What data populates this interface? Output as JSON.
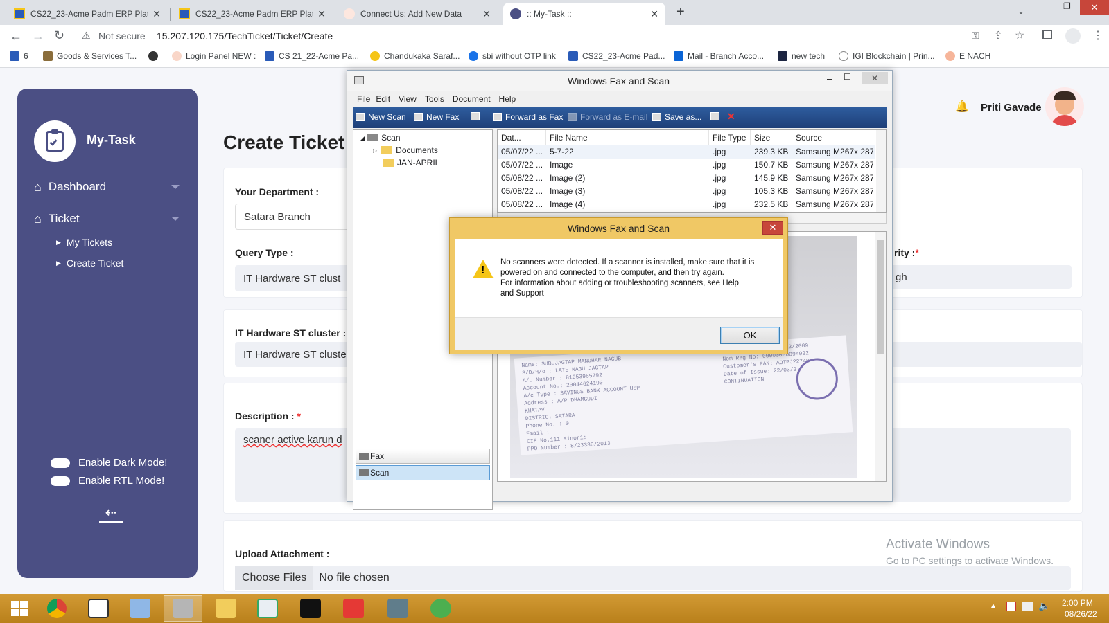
{
  "browser": {
    "tabs": [
      {
        "title": "CS22_23-Acme Padm ERP Platfor",
        "active": false
      },
      {
        "title": "CS22_23-Acme Padm ERP Platfor",
        "active": false
      },
      {
        "title": "Connect Us: Add New Data",
        "active": false
      },
      {
        "title": ":: My-Task ::",
        "active": true
      }
    ],
    "new_tab": "+",
    "security": "Not secure",
    "url": "15.207.120.175/TechTicket/Ticket/Create",
    "bookmarks": [
      "6",
      "Goods & Services T...",
      "",
      "Login Panel NEW :",
      "CS 21_22-Acme Pa...",
      "Chandukaka Saraf...",
      "sbi without OTP link",
      "CS22_23-Acme Pad...",
      "Mail - Branch Acco...",
      "new tech",
      "IGI Blockchain | Prin...",
      "E NACH"
    ]
  },
  "sidebar": {
    "app_name": "My-Task",
    "items": [
      {
        "label": "Dashboard"
      },
      {
        "label": "Ticket"
      }
    ],
    "subitems": [
      {
        "label": "My Tickets"
      },
      {
        "label": "Create Ticket"
      }
    ],
    "toggles": [
      {
        "label": "Enable Dark Mode!"
      },
      {
        "label": "Enable RTL Mode!"
      }
    ]
  },
  "header": {
    "page_title": "Create Ticket",
    "user_name": "Priti Gavade"
  },
  "form": {
    "department_label": "Your Department :",
    "department_value": "Satara Branch",
    "query_type_label": "Query Type :",
    "query_type_value": "IT Hardware ST clust",
    "priority_label": "rity :",
    "priority_value": "gh",
    "cluster_label": "IT Hardware ST cluster :",
    "cluster_value": "IT Hardware ST cluste",
    "description_label": "Description :",
    "description_value": "scaner active karun d",
    "upload_label": "Upload Attachment :",
    "choose_files": "Choose Files",
    "no_file": "No file chosen",
    "required_mark": "*"
  },
  "watermark": {
    "title": "Activate Windows",
    "subtitle": "Go to PC settings to activate Windows."
  },
  "fax_window": {
    "title": "Windows Fax and Scan",
    "menu": [
      "File",
      "Edit",
      "View",
      "Tools",
      "Document",
      "Help"
    ],
    "toolbar": [
      {
        "label": "New Scan",
        "enabled": true
      },
      {
        "label": "New Fax",
        "enabled": true
      },
      {
        "label": "Forward as Fax",
        "enabled": true
      },
      {
        "label": "Forward as E-mail",
        "enabled": false
      },
      {
        "label": "Save as...",
        "enabled": true
      }
    ],
    "tree": {
      "root": "Scan",
      "children": [
        "Documents",
        "JAN-APRIL"
      ]
    },
    "nav": [
      "Fax",
      "Scan"
    ],
    "columns": [
      "Dat...",
      "File Name",
      "File Type",
      "Size",
      "Source"
    ],
    "rows": [
      {
        "date": "05/07/22 ...",
        "name": "5-7-22",
        "type": ".jpg",
        "size": "239.3 KB",
        "source": "Samsung M267x 287x"
      },
      {
        "date": "05/07/22 ...",
        "name": "Image",
        "type": ".jpg",
        "size": "150.7 KB",
        "source": "Samsung M267x 287x"
      },
      {
        "date": "05/08/22 ...",
        "name": "Image (2)",
        "type": ".jpg",
        "size": "145.9 KB",
        "source": "Samsung M267x 287x"
      },
      {
        "date": "05/08/22 ...",
        "name": "Image (3)",
        "type": ".jpg",
        "size": "105.3 KB",
        "source": "Samsung M267x 287x"
      },
      {
        "date": "05/08/22 ...",
        "name": "Image (4)",
        "type": ".jpg",
        "size": "232.5 KB",
        "source": "Samsung M267x 287x"
      }
    ],
    "preview_lines": [
      "Name: SUB.JAGTAP MANOHAR NAGUB",
      "S/D/H/o  : LATE NAGU JAGTAP",
      "A/c Number : 81053965792",
      "Account No.: 20044624190",
      "A/c Type  : SAVINGS BANK ACCOUNT USP",
      "Address   : A/P DHAMGUDI",
      "            KHATAV",
      "            DISTRICT SATARA",
      "Phone No. : 0",
      "Email     :",
      "CIF No.111 Minor1:",
      "PPO Number : 8/23338/2013"
    ],
    "preview_right": [
      "A/C Opening Dt: 03/12/2009",
      "Nom Reg No: 00000000094922",
      "Customer's PAN: AOTPJ2274N",
      "Date of Issue: 22/03/2",
      "CONTINUATION"
    ]
  },
  "dialog": {
    "title": "Windows Fax and Scan",
    "close": "✕",
    "message1": "No scanners were detected. If a scanner is installed, make sure that it is",
    "message2": "powered on and connected to the computer, and then try again.",
    "message3": "For information about adding or troubleshooting scanners, see Help",
    "message4": "and Support",
    "ok": "OK"
  },
  "taskbar": {
    "time": "2:00 PM",
    "date": "08/26/22"
  },
  "colors": {
    "sidebar": "#4b4f84",
    "fax_toolbar": "#2e5d9e",
    "dialog_frame": "#f0c865",
    "taskbar": "#c88c28"
  }
}
